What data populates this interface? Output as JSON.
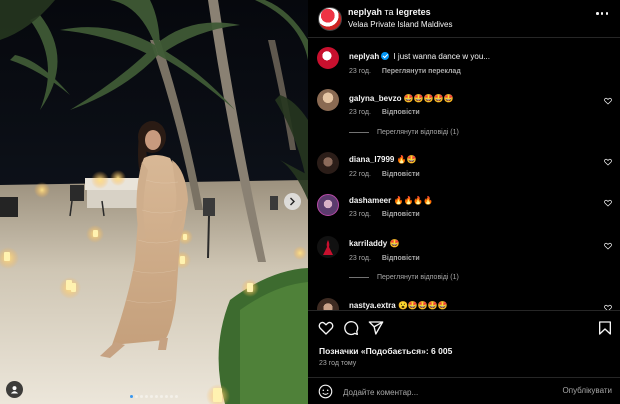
{
  "header": {
    "author": "neplyah",
    "conjunction": "та",
    "coauthor": "legretes",
    "location": "Velaa Private Island Maldives"
  },
  "comments": [
    {
      "username": "neplyah",
      "verified": true,
      "text": "I just wanna dance w you...",
      "time": "23 год.",
      "action": "Переглянути переклад",
      "avatar_color": "#c8102e",
      "caption": true
    },
    {
      "username": "galyna_bevzo",
      "text": "🤩🤩🤩🤩🤩",
      "time": "23 год.",
      "action": "Відповісти",
      "replies": "Переглянути відповіді (1)",
      "avatar_color": "#c9a27e"
    },
    {
      "username": "diana_l7999",
      "text": "🔥🤩",
      "time": "22 год.",
      "action": "Відповісти",
      "avatar_color": "#3b2a24"
    },
    {
      "username": "dashameer",
      "text": "🔥🔥🔥🔥",
      "time": "23 год.",
      "action": "Відповісти",
      "avatar_color": "#6b4a7a"
    },
    {
      "username": "karriladdy",
      "text": "🤩",
      "time": "23 год.",
      "action": "Відповісти",
      "replies": "Переглянути відповіді (1)",
      "avatar_color": "#1a1a1a"
    },
    {
      "username": "nastya.extra",
      "text": "😮🤩🤩🤩🤩",
      "avatar_color": "#5a4030"
    }
  ],
  "likes": {
    "label": "Позначки «Подобається»:",
    "count": "6 005"
  },
  "time_ago": "23 год тому",
  "comment_box": {
    "placeholder": "Додайте коментар...",
    "post_label": "Опублікувати"
  },
  "icons": {
    "heart": "heart-icon",
    "comment": "comment-icon",
    "share": "share-icon",
    "save": "bookmark-icon",
    "emoji": "emoji-icon",
    "more": "more-icon",
    "next": "chevron-right-icon",
    "tag": "user-tag-icon"
  },
  "carousel": {
    "total": 10,
    "active": 1
  },
  "colors": {
    "background": "#000000",
    "secondary_text": "#a8a8a8",
    "divider": "#262626",
    "verified": "#0095f6"
  }
}
